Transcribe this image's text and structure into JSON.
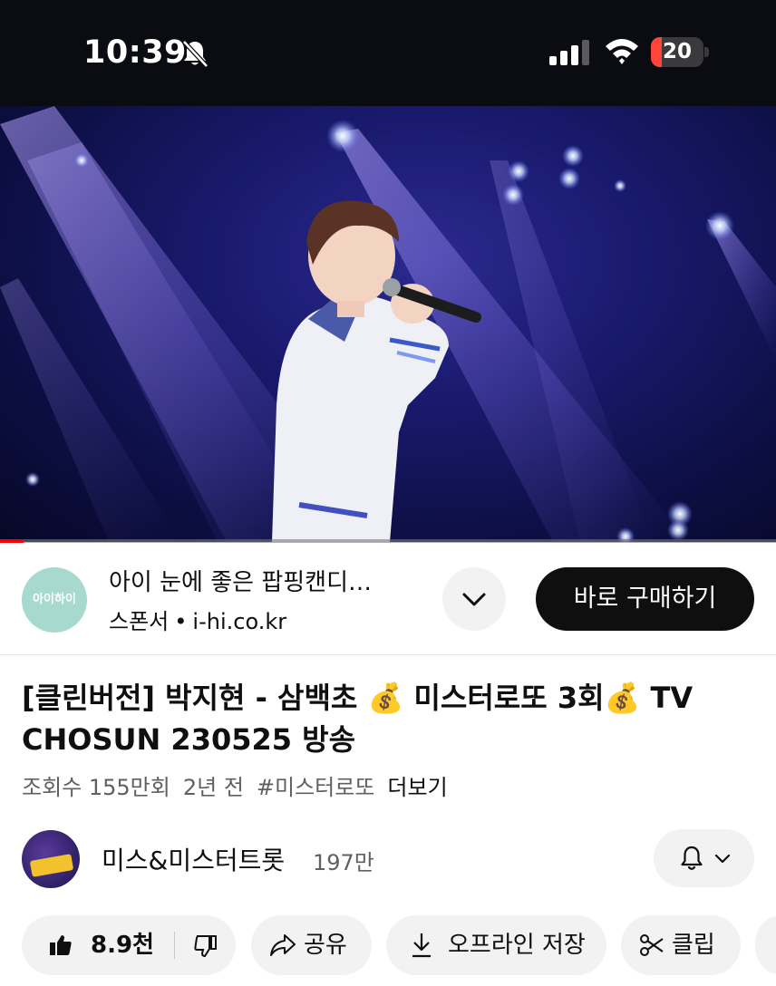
{
  "status_bar": {
    "time": "10:39",
    "battery": "20",
    "battery_level": 0.2,
    "icons": [
      "bell-off-icon",
      "signal-icon",
      "wifi-icon",
      "battery-icon"
    ]
  },
  "player": {
    "progress": 0.03
  },
  "ad": {
    "logo_text": "아이하이",
    "title": "아이 눈에 좋은 팝핑캔디…",
    "sponsor_label": "스폰서",
    "separator": "•",
    "domain": "i-hi.co.kr",
    "cta": "바로 구매하기",
    "colors": {
      "logo_bg": "#a8d9cf",
      "cta_bg": "#0f0f0f"
    }
  },
  "video": {
    "title": "[클린버전] 박지현 - 삼백초 💰 미스터로또 3회💰 TV CHOSUN 230525 방송",
    "views": "조회수 155만회",
    "age": "2년 전",
    "hashtag": "#미스터로또",
    "more": "더보기"
  },
  "channel": {
    "name": "미스&미스터트롯",
    "subscribers": "197만"
  },
  "actions": {
    "likes": "8.9천",
    "share": "공유",
    "download": "오프라인 저장",
    "clip": "클립"
  },
  "colors": {
    "progress": "#ff0000",
    "chip_bg": "#f2f2f2",
    "secondary_text": "#606060"
  }
}
